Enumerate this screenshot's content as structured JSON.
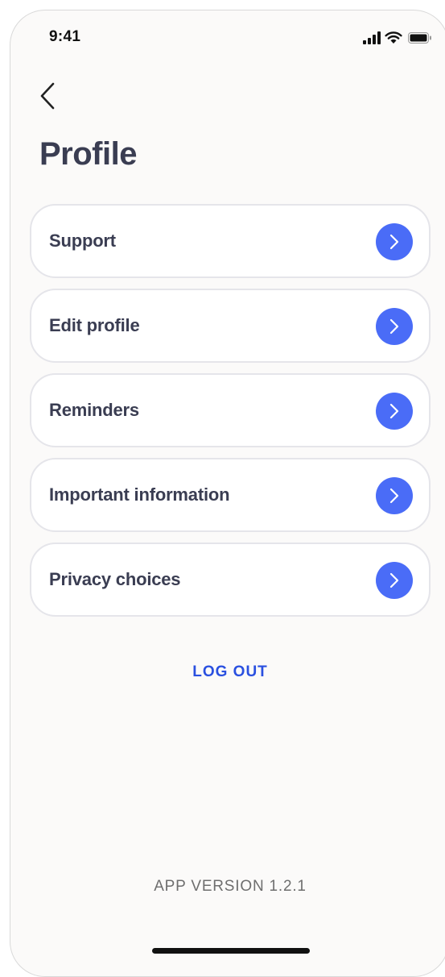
{
  "status_bar": {
    "time": "9:41"
  },
  "header": {
    "back_icon": "chevron-left-icon",
    "title": "Profile"
  },
  "menu": {
    "items": [
      {
        "label": "Support",
        "icon": "chevron-right-icon"
      },
      {
        "label": "Edit profile",
        "icon": "chevron-right-icon"
      },
      {
        "label": "Reminders",
        "icon": "chevron-right-icon"
      },
      {
        "label": "Important information",
        "icon": "chevron-right-icon"
      },
      {
        "label": "Privacy choices",
        "icon": "chevron-right-icon"
      }
    ]
  },
  "actions": {
    "logout_label": "LOG OUT"
  },
  "footer": {
    "app_version": "APP VERSION 1.2.1"
  },
  "colors": {
    "accent": "#4a6cf7",
    "link": "#2a50e0",
    "title_text": "#3a3d52",
    "background": "#fbfaf9",
    "card_border": "#e5e5ea"
  }
}
